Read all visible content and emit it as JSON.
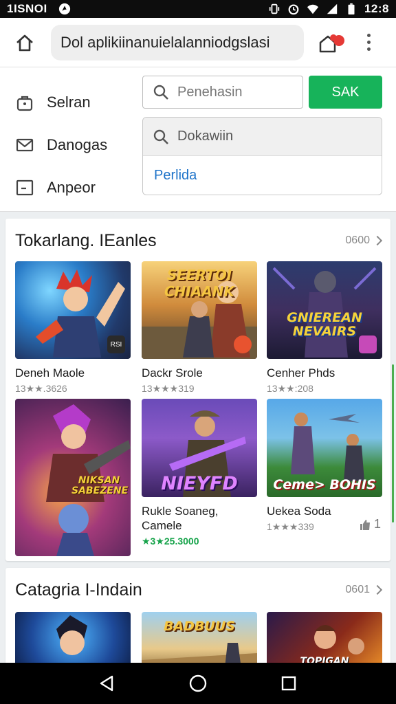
{
  "status_bar": {
    "time_left": "1ISNOI",
    "time_right": "12:8",
    "icons": [
      "brand-icon",
      "vibrate-icon",
      "alarm-icon",
      "wifi-icon",
      "signal-icon",
      "battery-icon"
    ]
  },
  "browser": {
    "url": "Dol aplikiinanuielalanniodgslasi",
    "icons": [
      "home-icon",
      "tabs-icon",
      "overflow-menu-icon"
    ]
  },
  "side_menu": [
    {
      "label": "Selran",
      "icon": "bag-icon"
    },
    {
      "label": "Danogas",
      "icon": "mail-icon"
    },
    {
      "label": "Anpeor",
      "icon": "box-icon"
    }
  ],
  "search": {
    "placeholder": "Penehasin",
    "button_label": "SAK"
  },
  "dropdown": {
    "search_placeholder": "Dokawiin",
    "option": "Perlida"
  },
  "section_1": {
    "title": "Tokarlang. IEanles",
    "more_label": "0600",
    "apps": [
      {
        "name": "Deneh Maole",
        "meta": "13★★.3626",
        "art_text": "",
        "badge": "RSI"
      },
      {
        "name": "Dackr Srole",
        "meta": "13★★★319",
        "art_text": "SEERTOI CHIAANK",
        "badge": ""
      },
      {
        "name": "Cenher Phds",
        "meta": "13★★:208",
        "art_text": "GNIEREAN NEVAIRS",
        "badge": ""
      },
      {
        "name": "",
        "meta": "",
        "art_text": "NIKSAN SABEZENE",
        "badge": ""
      },
      {
        "name": "Rukle Soaneg, Camele",
        "meta": "★3★25.3000",
        "art_text": "NIEYFD",
        "badge": ""
      },
      {
        "name": "Uekea Soda",
        "meta": "1★★★339",
        "art_text": "Ceme> BOHIS",
        "badge": ""
      }
    ],
    "side_stat": "1"
  },
  "section_2": {
    "title": "Catagria I-Indain",
    "more_label": "0601",
    "apps": [
      {
        "art_text": ""
      },
      {
        "art_text": "BADBUUS"
      },
      {
        "art_text": "TOPIGAN"
      }
    ]
  },
  "nav_bar": {
    "icons": [
      "back-icon",
      "home-circle-icon",
      "recents-icon"
    ]
  },
  "colors": {
    "accent_green": "#17b35a",
    "link_blue": "#1e73c9"
  }
}
